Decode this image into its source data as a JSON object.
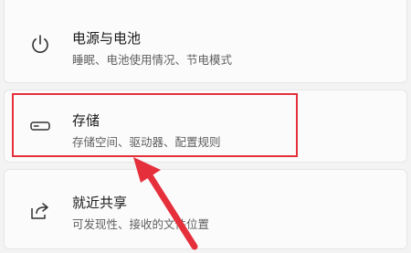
{
  "settings": {
    "items": [
      {
        "title": "电源与电池",
        "subtitle": "睡眠、电池使用情况、节电模式",
        "icon": "power-icon"
      },
      {
        "title": "存储",
        "subtitle": "存储空间、驱动器、配置规则",
        "icon": "storage-drive-icon"
      },
      {
        "title": "就近共享",
        "subtitle": "可发现性、接收的文件位置",
        "icon": "share-icon"
      }
    ]
  },
  "annotation": {
    "highlight_color": "#e5303c",
    "arrow_color": "#e5303c"
  }
}
